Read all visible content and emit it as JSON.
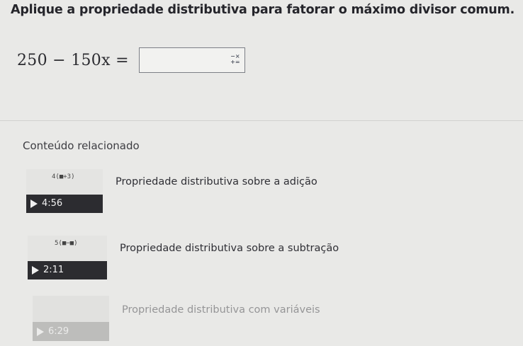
{
  "question": {
    "text": "Aplique a propriedade distributiva para fatorar o máximo divisor comum."
  },
  "equation": {
    "text": "250 − 150x =",
    "answer_value": "",
    "math_keyboard_icon": "math-keypad-icon"
  },
  "related": {
    "title": "Conteúdo relacionado",
    "videos": [
      {
        "title": "Propriedade distributiva sobre a adição",
        "duration": "4:56",
        "icon": "play-icon"
      },
      {
        "title": "Propriedade distributiva sobre a subtração",
        "duration": "2:11",
        "icon": "play-icon"
      },
      {
        "title": "Propriedade distributiva com variáveis",
        "duration": "6:29",
        "icon": "play-icon"
      }
    ]
  }
}
